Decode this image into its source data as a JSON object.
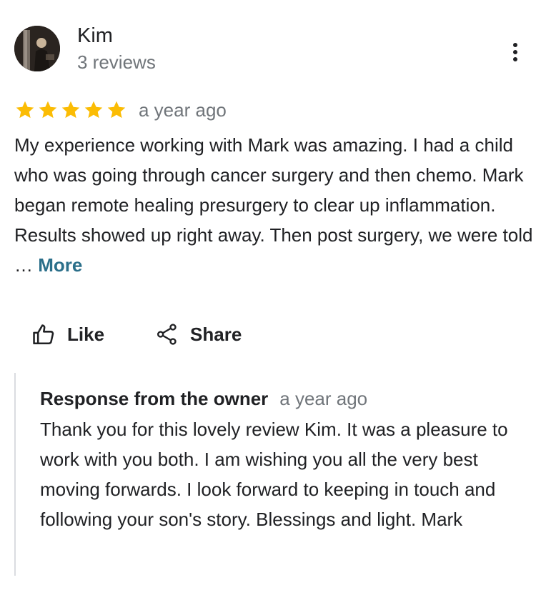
{
  "reviewer": {
    "name": "Kim",
    "review_count": "3 reviews",
    "avatar": "profile-photo"
  },
  "review": {
    "rating": 5,
    "max_rating": 5,
    "star_color": "#fbbc04",
    "date": "a year ago",
    "text": "My experience working with Mark was amazing. I had a child who was going through cancer surgery and  then chemo. Mark began remote healing presurgery to clear up inflammation. Results showed up right away. Then post surgery, we were told … ",
    "more_label": "More",
    "more_color": "#2b6f8a"
  },
  "actions": {
    "like_label": "Like",
    "like_icon": "thumbs-up-icon",
    "share_label": "Share",
    "share_icon": "share-icon"
  },
  "menu_icon": "more-vert-icon",
  "owner_response": {
    "title": "Response from the owner",
    "date": "a year ago",
    "text": "Thank you for this lovely review Kim. It was a pleasure to work with you both. I am wishing you all the very best moving forwards. I look forward to keeping in touch and following your son's story. Blessings and light. Mark"
  }
}
